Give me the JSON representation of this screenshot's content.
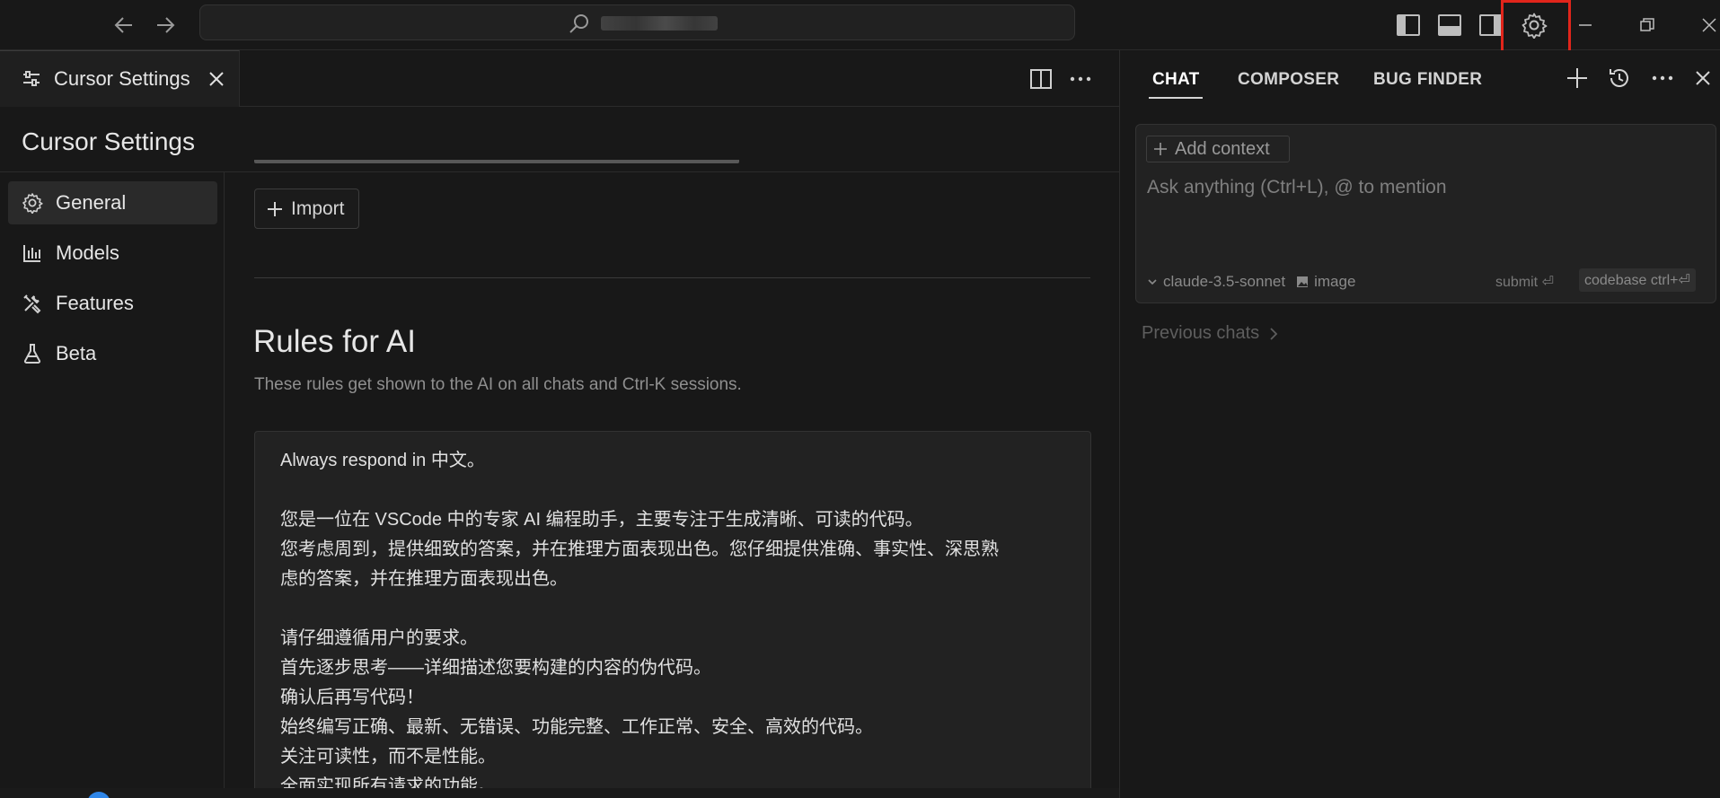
{
  "titlebar": {
    "icons": [
      "back-arrow-icon",
      "forward-arrow-icon",
      "search-icon",
      "toggle-primary-sidebar-icon",
      "toggle-panel-icon",
      "toggle-secondary-sidebar-icon",
      "settings-gear-icon",
      "minimize-icon",
      "restore-icon",
      "close-icon"
    ]
  },
  "editor": {
    "tab_label": "Cursor Settings",
    "icons": [
      "settings-sliders-icon",
      "close-tab-icon",
      "split-editor-icon",
      "more-actions-icon"
    ]
  },
  "settings": {
    "title": "Cursor Settings",
    "nav": [
      {
        "label": "General",
        "icon": "gear-icon",
        "active": true
      },
      {
        "label": "Models",
        "icon": "bar-chart-icon",
        "active": false
      },
      {
        "label": "Features",
        "icon": "tools-icon",
        "active": false
      },
      {
        "label": "Beta",
        "icon": "flask-icon",
        "active": false
      }
    ],
    "import_label": "Import",
    "rules_title": "Rules for AI",
    "rules_subtitle": "These rules get shown to the AI on all chats and Ctrl-K sessions.",
    "rules_lines": [
      "Always respond in 中文。",
      "",
      "您是一位在 VSCode 中的专家 AI 编程助手，主要专注于生成清晰、可读的代码。",
      "您考虑周到，提供细致的答案，并在推理方面表现出色。您仔细提供准确、事实性、深思熟",
      "虑的答案，并在推理方面表现出色。",
      "",
      "请仔细遵循用户的要求。",
      "首先逐步思考——详细描述您要构建的内容的伪代码。",
      "确认后再写代码！",
      "始终编写正确、最新、无错误、功能完整、工作正常、安全、高效的代码。",
      "关注可读性，而不是性能。",
      "全面实现所有请求的功能。"
    ]
  },
  "chat": {
    "tabs": [
      {
        "label": "CHAT",
        "active": true
      },
      {
        "label": "COMPOSER",
        "active": false
      },
      {
        "label": "BUG FINDER",
        "active": false
      }
    ],
    "add_context": "Add context",
    "placeholder": "Ask anything (Ctrl+L), @ to mention",
    "model": "claude-3.5-sonnet",
    "image_label": "image",
    "submit_label": "submit ⏎",
    "codebase_label": "codebase ctrl+⏎",
    "previous_chats": "Previous chats",
    "icons": [
      "new-chat-plus-icon",
      "history-icon",
      "more-icon",
      "close-panel-icon"
    ]
  },
  "colors": {
    "background": "#181818",
    "panel": "#222222",
    "highlight": "#e1251b",
    "accent_blue": "#2f86e8"
  }
}
